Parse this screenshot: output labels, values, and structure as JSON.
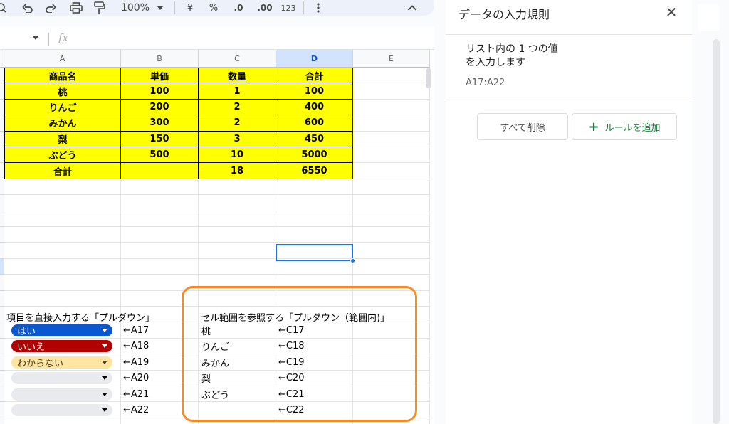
{
  "toolbar": {
    "zoom": "100%",
    "currency": "¥",
    "percent": "%",
    "decimal_decrease": ".0",
    "decimal_increase": ".00",
    "number_format": "123"
  },
  "columns": [
    "A",
    "B",
    "C",
    "D",
    "E"
  ],
  "table": {
    "header": [
      "商品名",
      "単価",
      "数量",
      "合計"
    ],
    "rows": [
      [
        "桃",
        "100",
        "1",
        "100"
      ],
      [
        "りんご",
        "200",
        "2",
        "400"
      ],
      [
        "みかん",
        "300",
        "2",
        "600"
      ],
      [
        "梨",
        "150",
        "3",
        "450"
      ],
      [
        "ぶどう",
        "500",
        "10",
        "5000"
      ],
      [
        "合計",
        "",
        "18",
        "6550"
      ]
    ]
  },
  "labels": {
    "left": "項目を直接入力する「プルダウン」",
    "right": "セル範囲を参照する「プルダウン（範囲内)」"
  },
  "dropdowns": [
    {
      "value": "はい",
      "bg": "#0b57d0",
      "fg": "#ffffff",
      "ref": "←A17"
    },
    {
      "value": "いいえ",
      "bg": "#b10202",
      "fg": "#ffffff",
      "ref": "←A18"
    },
    {
      "value": "わからない",
      "bg": "#ffe5a0",
      "fg": "#473821",
      "ref": "←A19"
    },
    {
      "value": "",
      "bg": "#e8eaed",
      "fg": "#000000",
      "ref": "←A20"
    },
    {
      "value": "",
      "bg": "#e8eaed",
      "fg": "#000000",
      "ref": "←A21"
    },
    {
      "value": "",
      "bg": "#e8eaed",
      "fg": "#000000",
      "ref": "←A22"
    }
  ],
  "range_list": [
    {
      "item": "桃",
      "ref": "←C17"
    },
    {
      "item": "りんご",
      "ref": "←C18"
    },
    {
      "item": "みかん",
      "ref": "←C19"
    },
    {
      "item": "梨",
      "ref": "←C20"
    },
    {
      "item": "ぶどう",
      "ref": "←C21"
    },
    {
      "item": "",
      "ref": "←C22"
    }
  ],
  "panel": {
    "title": "データの入力規則",
    "rule_text": "リスト内の 1 つの値\nを入力します",
    "range": "A17:A22",
    "delete_all": "すべて削除",
    "add_rule": "ルールを追加"
  },
  "colors": {
    "highlight_yellow": "#ffff00",
    "selection_blue": "#1a73e8",
    "annotation_orange": "#f68b29",
    "add_rule_green": "#188038"
  }
}
